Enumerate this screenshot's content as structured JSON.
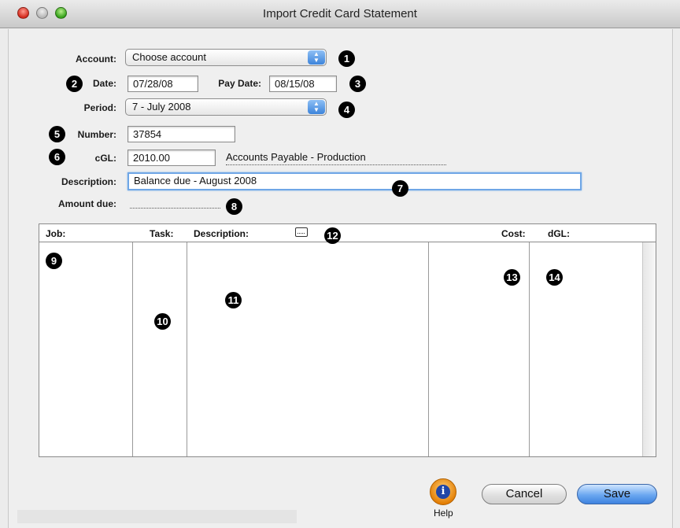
{
  "window": {
    "title": "Import Credit Card Statement"
  },
  "form": {
    "account_label": "Account:",
    "account_value": "Choose account",
    "date_label": "Date:",
    "date_value": "07/28/08",
    "pay_date_label": "Pay Date:",
    "pay_date_value": "08/15/08",
    "period_label": "Period:",
    "period_value": "7 - July 2008",
    "number_label": "Number:",
    "number_value": "37854",
    "cgl_label": "cGL:",
    "cgl_value": "2010.00",
    "cgl_account_name": "Accounts Payable - Production",
    "description_label": "Description:",
    "description_value": "Balance due - August 2008",
    "amount_due_label": "Amount due:"
  },
  "grid": {
    "columns": [
      "Job:",
      "Task:",
      "Description:",
      "Cost:",
      "dGL:"
    ],
    "rows": []
  },
  "callouts": [
    "1",
    "2",
    "3",
    "4",
    "5",
    "6",
    "7",
    "8",
    "9",
    "10",
    "11",
    "12",
    "13",
    "14"
  ],
  "footer": {
    "help_label": "Help",
    "cancel_label": "Cancel",
    "save_label": "Save"
  },
  "icons": {
    "help": "info-icon",
    "popup": "updown-arrows-icon",
    "description_header": "keyboard-icon"
  },
  "colors": {
    "accent": "#3e82df",
    "help": "#e27b00"
  }
}
